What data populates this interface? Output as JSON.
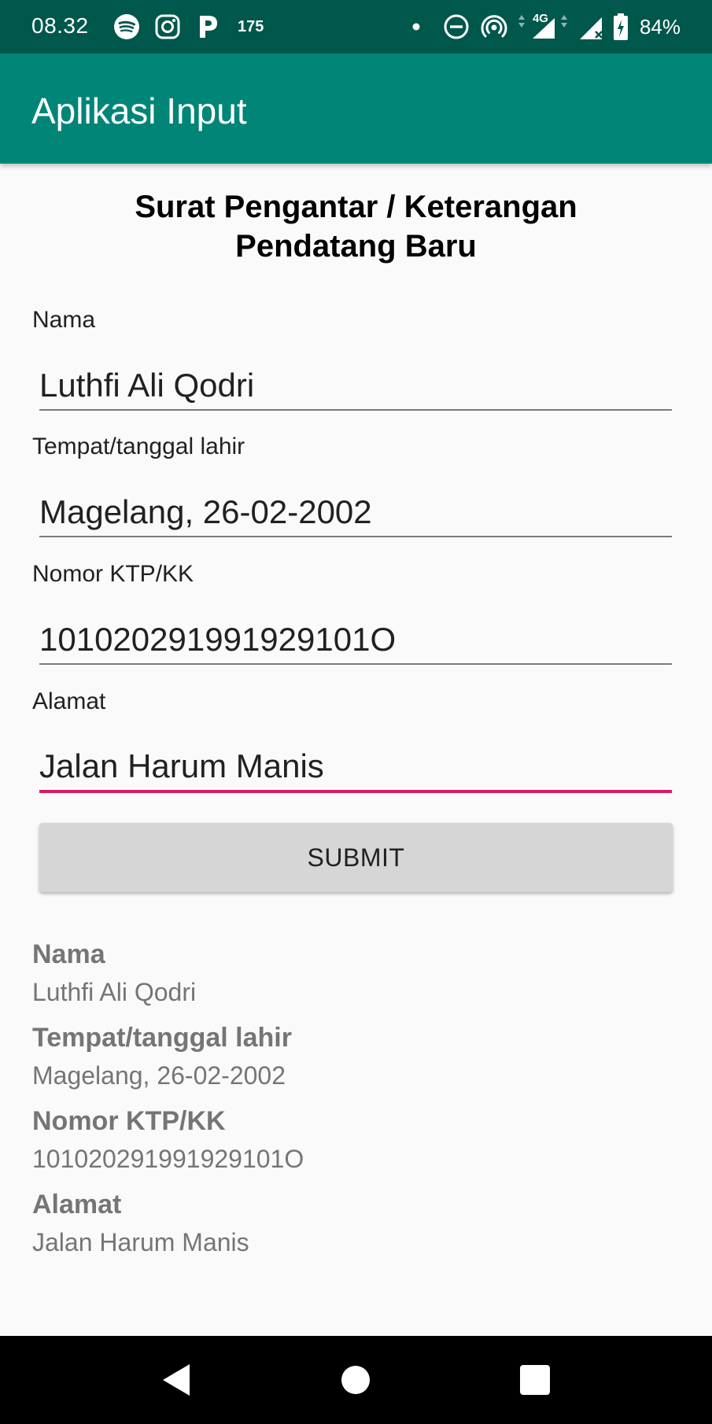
{
  "status_bar": {
    "time": "08.32",
    "notification_count": "175",
    "network_type": "4G",
    "battery_percent": "84%",
    "icons": [
      "spotify-icon",
      "instagram-icon",
      "p-app-icon",
      "dot-icon",
      "dnd-icon",
      "hotspot-icon",
      "data-signal-icon",
      "cell-signal-icon",
      "battery-icon"
    ]
  },
  "app_bar": {
    "title": "Aplikasi Input"
  },
  "form": {
    "heading_line1": "Surat Pengantar / Keterangan",
    "heading_line2": "Pendatang Baru",
    "fields": [
      {
        "label": "Nama",
        "value": "Luthfi Ali Qodri"
      },
      {
        "label": "Tempat/tanggal lahir",
        "value": "Magelang, 26-02-2002"
      },
      {
        "label": "Nomor KTP/KK",
        "value": "101020291991929101O"
      },
      {
        "label": "Alamat",
        "value": "Jalan Harum Manis"
      }
    ],
    "submit_label": "SUBMIT"
  },
  "results": [
    {
      "label": "Nama",
      "value": "Luthfi Ali Qodri"
    },
    {
      "label": "Tempat/tanggal lahir",
      "value": "Magelang, 26-02-2002"
    },
    {
      "label": "Nomor KTP/KK",
      "value": "101020291991929101O"
    },
    {
      "label": "Alamat",
      "value": "Jalan Harum Manis"
    }
  ],
  "nav_bar": {
    "icons": [
      "back-icon",
      "home-icon",
      "recents-icon"
    ]
  },
  "colors": {
    "status_bar": "#00574b",
    "app_bar": "#008577",
    "accent": "#d81b60",
    "result_text": "#757575"
  }
}
